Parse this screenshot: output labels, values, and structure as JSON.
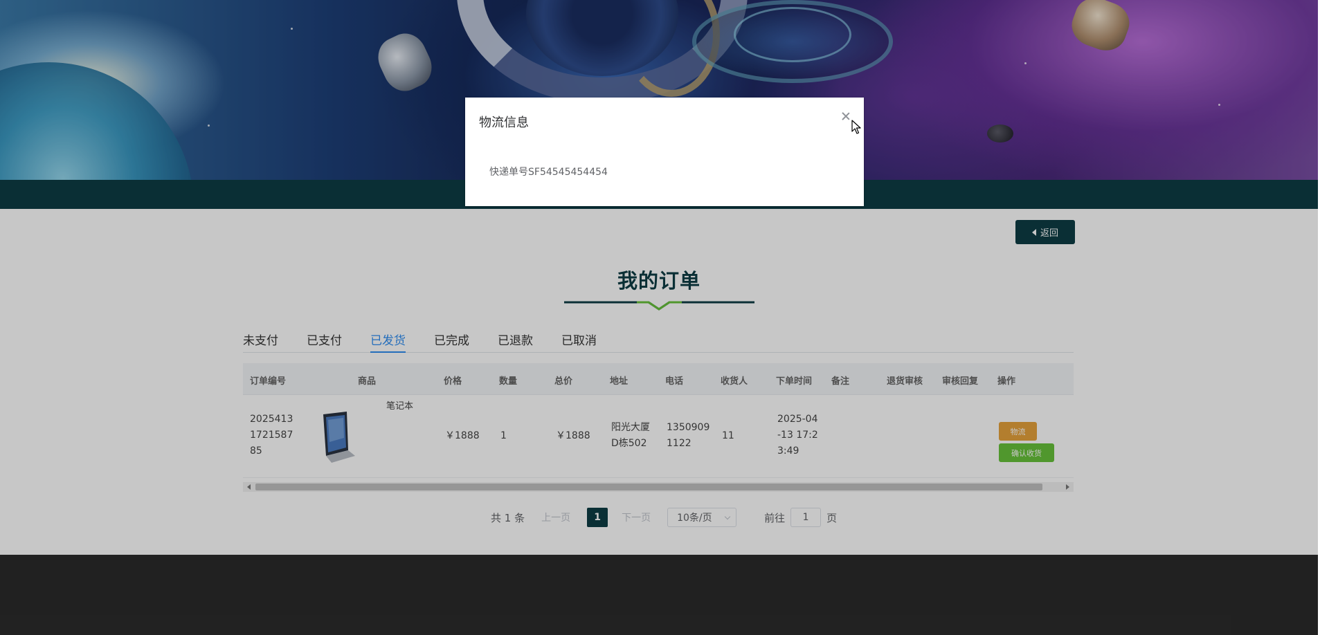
{
  "header": {
    "banner_image": "space-banner"
  },
  "back_button": {
    "label": "返回",
    "icon": "caret-left-icon"
  },
  "page_title": "我的订单",
  "tabs": [
    {
      "label": "未支付",
      "active": false
    },
    {
      "label": "已支付",
      "active": false
    },
    {
      "label": "已发货",
      "active": true
    },
    {
      "label": "已完成",
      "active": false
    },
    {
      "label": "已退款",
      "active": false
    },
    {
      "label": "已取消",
      "active": false
    }
  ],
  "table": {
    "columns": [
      "订单编号",
      "商品",
      "价格",
      "数量",
      "总价",
      "地址",
      "电话",
      "收货人",
      "下单时间",
      "备注",
      "退货审核",
      "审核回复",
      "操作"
    ],
    "rows": [
      {
        "order_no": "2025413\n1721587\n85",
        "product_name": "笔记本",
        "price": "￥1888",
        "quantity": "1",
        "total": "￥1888",
        "address": "阳光大厦\nD栋502",
        "phone": "1350909\n1122",
        "receiver": "11",
        "order_time": "2025-04\n-13 17:2\n3:49",
        "remark": "",
        "return_review": "",
        "review_reply": "",
        "actions": {
          "logistics": "物流",
          "confirm": "确认收货"
        }
      }
    ]
  },
  "pagination": {
    "total": "共 1 条",
    "prev": "上一页",
    "current": "1",
    "next": "下一页",
    "page_size": "10条/页",
    "goto_label": "前往",
    "goto_value": "1",
    "goto_suffix": "页"
  },
  "modal": {
    "title": "物流信息",
    "body": "快递单号SF54545454454"
  },
  "colors": {
    "primary_dark": "#0d3d45",
    "active_tab": "#2d8cf0",
    "logistics_button": "#e6a23c",
    "confirm_button": "#67c23a",
    "footer": "#2b2b2b"
  }
}
